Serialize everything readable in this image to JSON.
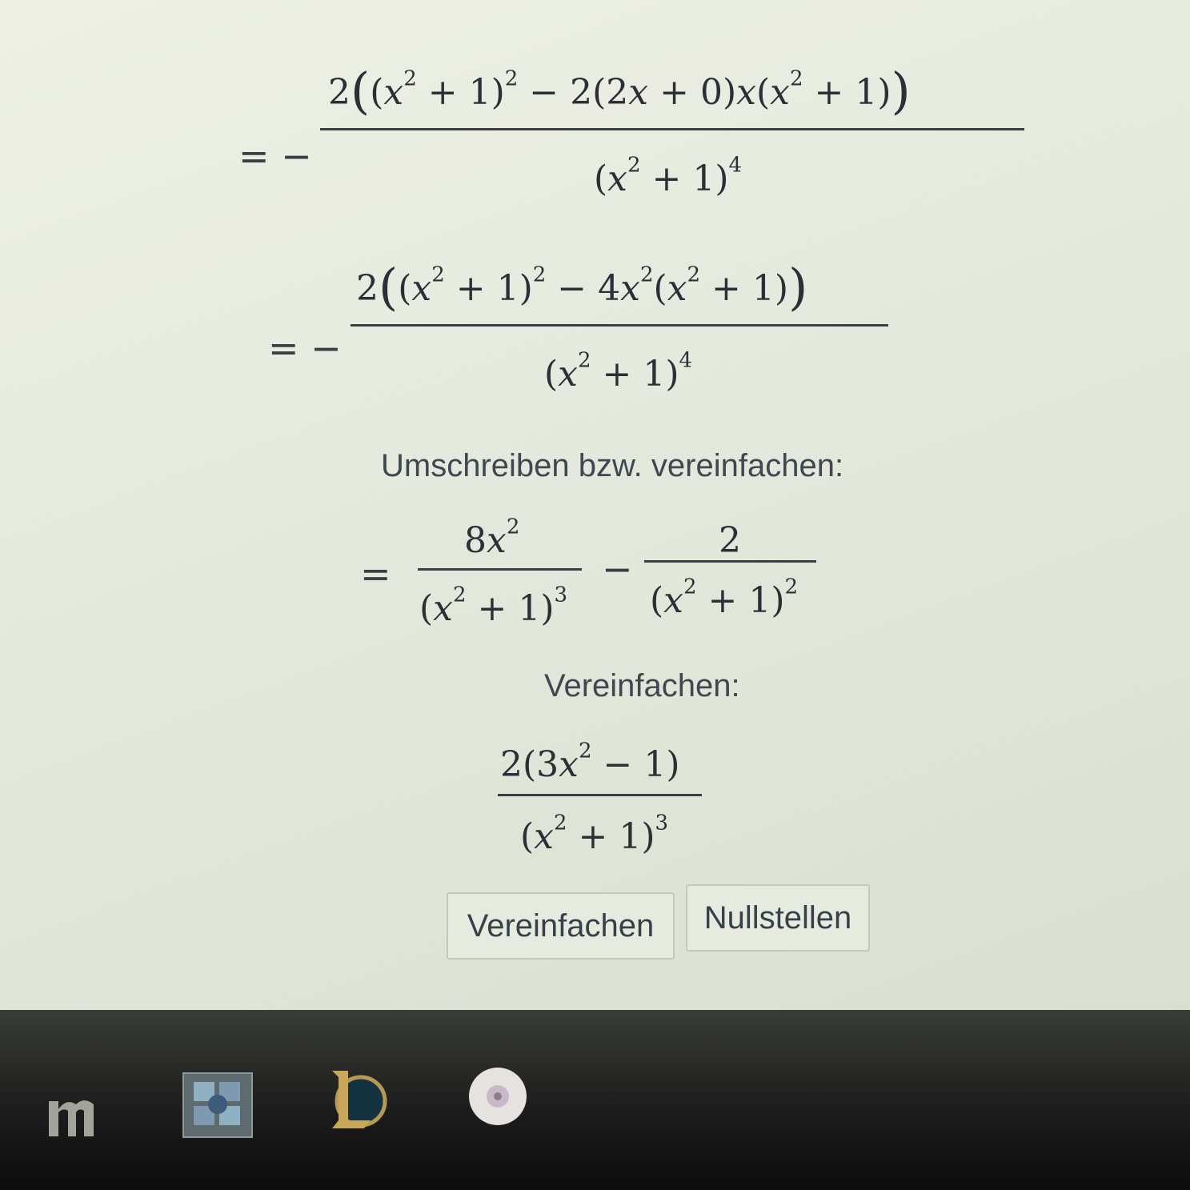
{
  "steps": [
    {
      "prefix": "= −",
      "numerator": "2((x²+1)² − 2(2x+0)x(x²+1))",
      "denominator": "(x²+1)⁴"
    },
    {
      "prefix": "= −",
      "numerator": "2((x²+1)² − 4x²(x²+1))",
      "denominator": "(x²+1)⁴"
    }
  ],
  "section_rewrite": {
    "label": "Umschreiben bzw. vereinfachen:",
    "prefix": "=",
    "term1_num": "8x²",
    "term1_den": "(x²+1)³",
    "operator": "−",
    "term2_num": "2",
    "term2_den": "(x²+1)²"
  },
  "section_simplify": {
    "label": "Vereinfachen:",
    "numerator": "2(3x² − 1)",
    "denominator": "(x²+1)³"
  },
  "buttons": {
    "simplify": "Vereinfachen",
    "zeros": "Nullstellen"
  },
  "taskbar_icons": [
    "mathematica-icon",
    "app-grid-icon",
    "league-of-legends-icon",
    "disc-app-icon"
  ],
  "colors": {
    "taskbar": "#1a1b1a",
    "text": "#2b3036"
  }
}
